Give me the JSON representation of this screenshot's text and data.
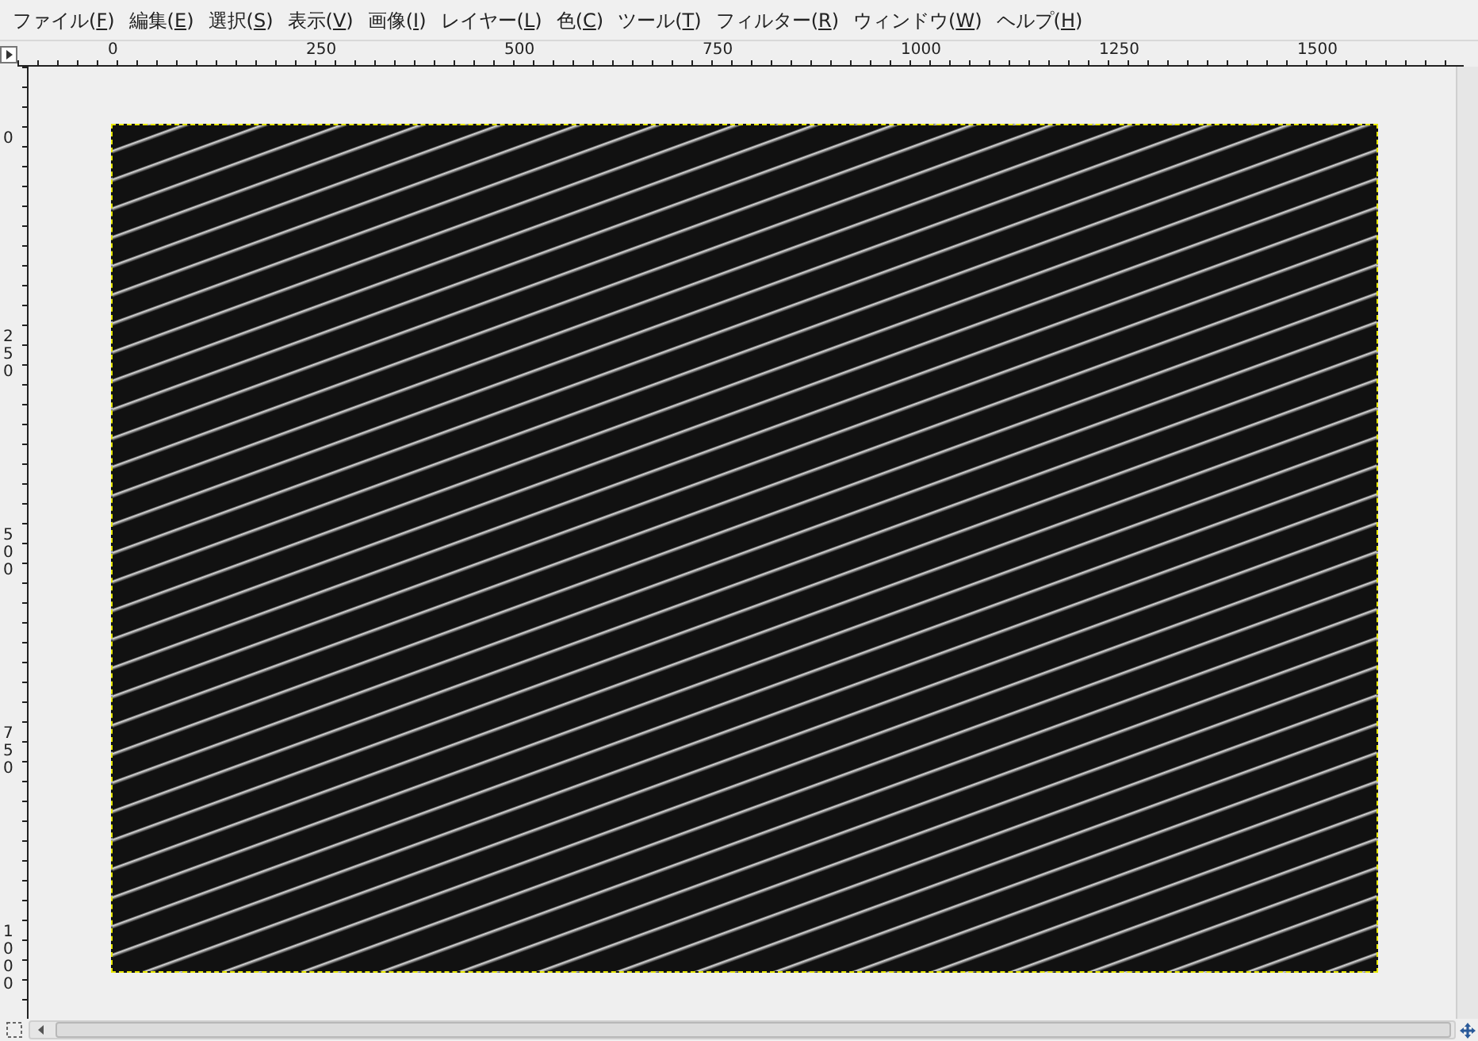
{
  "menu": [
    {
      "before": "ファイル(",
      "key": "F",
      "after": ")"
    },
    {
      "before": "編集(",
      "key": "E",
      "after": ")"
    },
    {
      "before": "選択(",
      "key": "S",
      "after": ")"
    },
    {
      "before": "表示(",
      "key": "V",
      "after": ")"
    },
    {
      "before": "画像(",
      "key": "I",
      "after": ")"
    },
    {
      "before": "レイヤー(",
      "key": "L",
      "after": ")"
    },
    {
      "before": "色(",
      "key": "C",
      "after": ")"
    },
    {
      "before": "ツール(",
      "key": "T",
      "after": ")"
    },
    {
      "before": "フィルター(",
      "key": "R",
      "after": ")"
    },
    {
      "before": "ウィンドウ(",
      "key": "W",
      "after": ")"
    },
    {
      "before": "ヘルプ(",
      "key": "H",
      "after": ")"
    }
  ],
  "horizontal_ruler": {
    "labels": [
      "0",
      "250",
      "500",
      "750",
      "1000",
      "1250",
      "1500"
    ]
  },
  "vertical_ruler": {
    "labels": [
      "0",
      "250",
      "500",
      "750",
      "1000"
    ]
  }
}
